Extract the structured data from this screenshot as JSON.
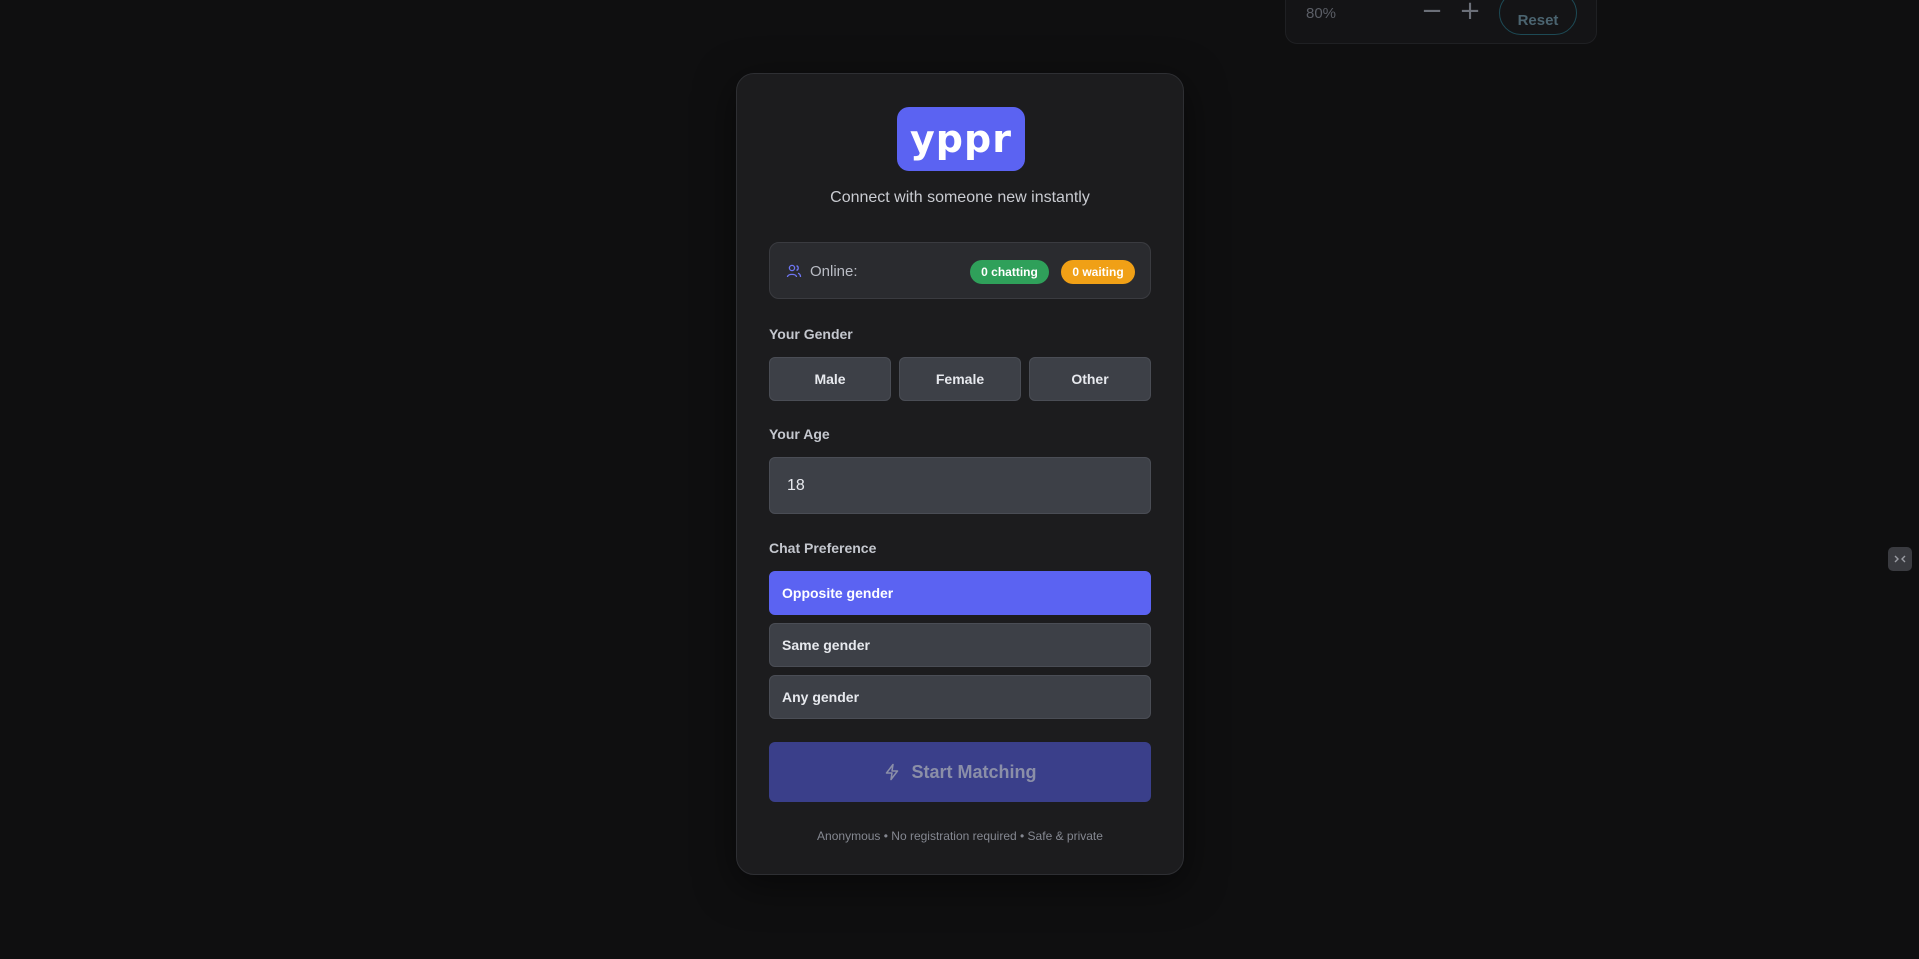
{
  "zoom": {
    "level": "80%",
    "minus_icon": "minus-icon",
    "plus_icon": "plus-icon",
    "reset_label": "Reset"
  },
  "brand": {
    "logo_text": "yppr",
    "tagline": "Connect with someone new instantly",
    "accent": "#5b63f2"
  },
  "online": {
    "label": "Online:",
    "icon": "users-icon",
    "chatting": "0 chatting",
    "waiting": "0 waiting",
    "chatting_color": "#2fa05a",
    "waiting_color": "#f0a016"
  },
  "gender": {
    "label": "Your Gender",
    "options": [
      "Male",
      "Female",
      "Other"
    ]
  },
  "age": {
    "label": "Your Age",
    "value": "18"
  },
  "preference": {
    "label": "Chat Preference",
    "options": [
      "Opposite gender",
      "Same gender",
      "Any gender"
    ],
    "selected": "Opposite gender"
  },
  "start": {
    "label": "Start Matching",
    "icon": "lightning-icon"
  },
  "footer": {
    "note": "Anonymous • No registration required • Safe & private"
  }
}
